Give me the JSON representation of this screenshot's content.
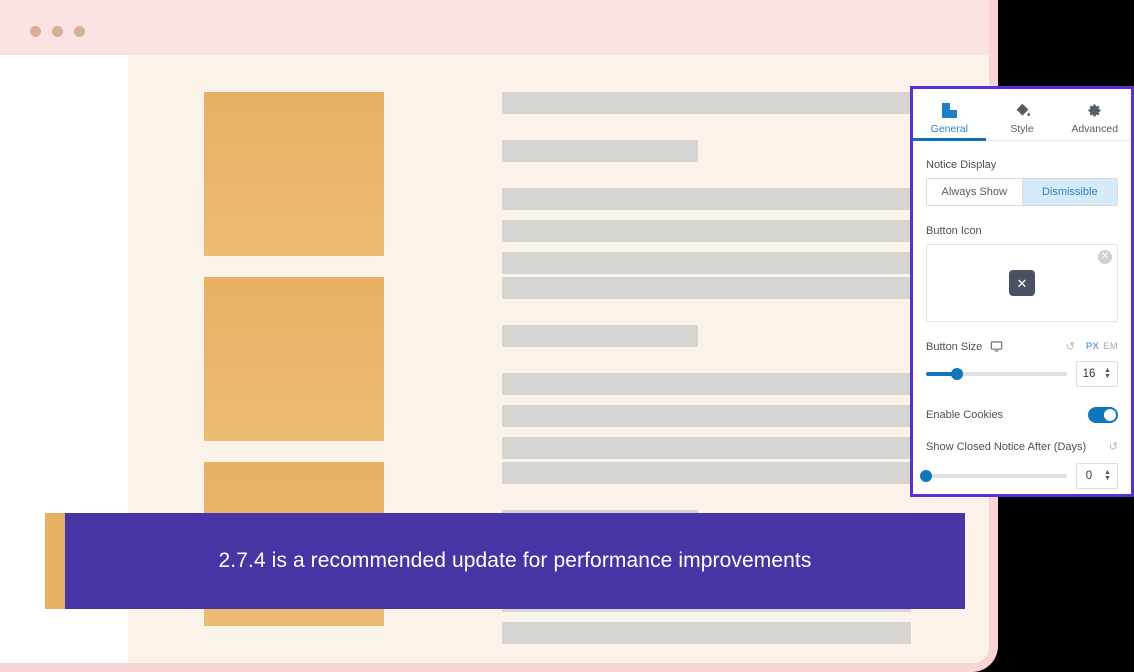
{
  "browser": {
    "title_bar": {
      "traffic_lights": [
        "close-dot",
        "minimize-dot",
        "maximize-dot"
      ]
    }
  },
  "page_preview": {
    "rows": [
      {
        "thumb_height": 164,
        "lines": [
          22,
          14,
          0,
          16,
          16,
          16
        ]
      },
      {
        "thumb_height": 164,
        "lines": [
          22,
          14,
          0,
          16,
          16,
          16
        ]
      },
      {
        "thumb_height": 164,
        "lines": [
          22,
          14,
          0,
          16,
          16,
          16
        ]
      }
    ]
  },
  "notice": {
    "text": "2.7.4 is a recommended update for performance improvements",
    "accent_color": "#E8B063",
    "background_color": "#4834A4",
    "text_color": "#FFFFFF"
  },
  "panel": {
    "border_color": "#5B2FD6",
    "tabs": [
      {
        "label": "General",
        "icon": "square-block-icon",
        "active": true
      },
      {
        "label": "Style",
        "icon": "paint-bucket-icon",
        "active": false
      },
      {
        "label": "Advanced",
        "icon": "gear-icon",
        "active": false
      }
    ],
    "notice_display": {
      "label": "Notice Display",
      "options": [
        {
          "label": "Always Show",
          "active": false
        },
        {
          "label": "Dismissible",
          "active": true
        }
      ]
    },
    "button_icon": {
      "label": "Button Icon",
      "glyph": "✕",
      "remove_glyph": "✕"
    },
    "button_size": {
      "label": "Button Size",
      "device_icon": "desktop-icon",
      "reset_icon": "↺",
      "units": [
        {
          "label": "PX",
          "active": true
        },
        {
          "label": "EM",
          "active": false
        }
      ],
      "value": "16",
      "slider_percent": 22
    },
    "enable_cookies": {
      "label": "Enable Cookies",
      "on": true
    },
    "show_closed_notice": {
      "label": "Show Closed Notice After (Days)",
      "reset_icon": "↺",
      "value": "0",
      "slider_percent": 0
    }
  }
}
